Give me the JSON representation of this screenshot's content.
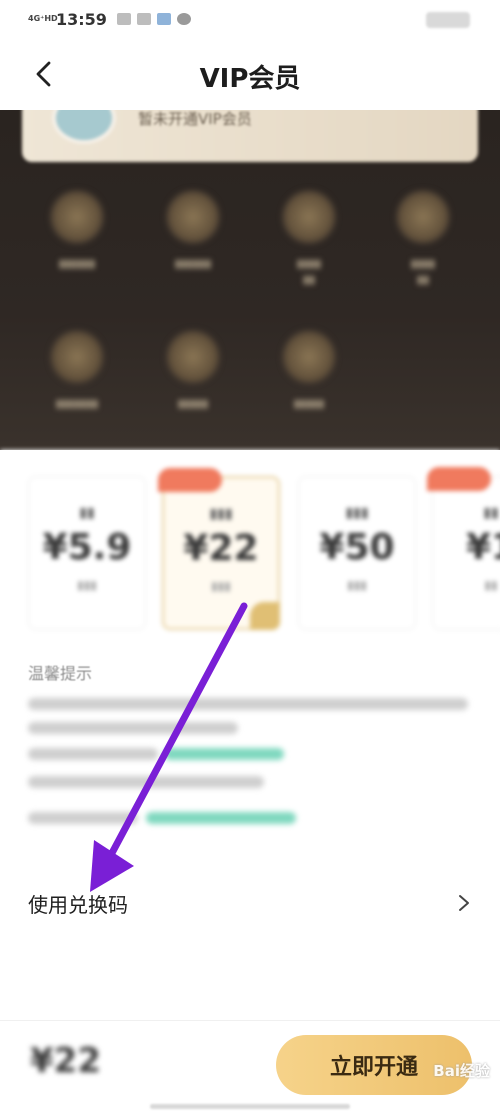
{
  "status_bar": {
    "network": "4G⁺HD",
    "time": "13:59"
  },
  "header": {
    "title": "VIP会员"
  },
  "member": {
    "status": "暂未开通VIP会员"
  },
  "tips": {
    "title": "温馨提示"
  },
  "redeem": {
    "label": "使用兑换码"
  },
  "bottom_bar": {
    "price": "¥22",
    "buy_label": "立即开通"
  },
  "plans": [
    {
      "price": "¥5.9"
    },
    {
      "price": "¥22"
    },
    {
      "price": "¥50"
    },
    {
      "price": "¥1"
    }
  ],
  "watermark": "Bai经验",
  "colors": {
    "accent_gold": "#f2c978",
    "annotation_purple": "#7a1fd6",
    "dark_panel": "#2c2521",
    "tag_red": "#f07a5e"
  }
}
